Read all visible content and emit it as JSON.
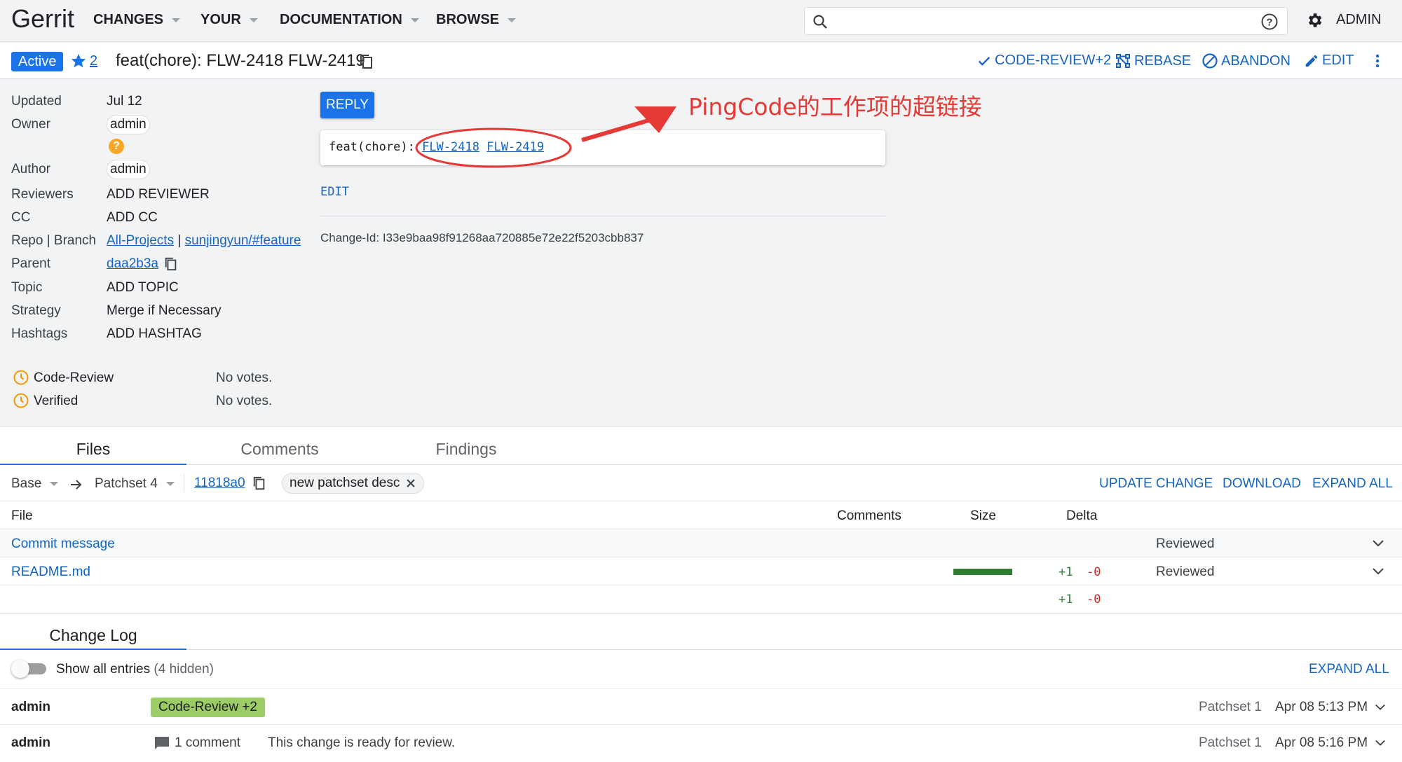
{
  "header": {
    "logo": "Gerrit",
    "nav": [
      "CHANGES",
      "YOUR",
      "DOCUMENTATION",
      "BROWSE"
    ],
    "search_placeholder": "",
    "user_menu": "ADMIN"
  },
  "change": {
    "status": "Active",
    "star_count": "2",
    "subject": "feat(chore): FLW-2418 FLW-2419",
    "actions": [
      "CODE-REVIEW+2",
      "REBASE",
      "ABANDON",
      "EDIT"
    ]
  },
  "metadata": {
    "updated_label": "Updated",
    "updated_value": "Jul 12",
    "owner_label": "Owner",
    "owner_value": "admin",
    "owner_badge": "?",
    "author_label": "Author",
    "author_value": "admin",
    "reviewers_label": "Reviewers",
    "reviewers_value": "ADD REVIEWER",
    "cc_label": "CC",
    "cc_value": "ADD CC",
    "repo_label": "Repo | Branch",
    "repo_value": "All-Projects",
    "repo_sep": " | ",
    "branch_value": "sunjingyun/#feature",
    "parent_label": "Parent",
    "parent_value": "daa2b3a",
    "topic_label": "Topic",
    "topic_value": "ADD TOPIC",
    "strategy_label": "Strategy",
    "strategy_value": "Merge if Necessary",
    "hashtags_label": "Hashtags",
    "hashtags_value": "ADD HASHTAG"
  },
  "labels": [
    {
      "name": "Code-Review",
      "value": "No votes."
    },
    {
      "name": "Verified",
      "value": "No votes."
    }
  ],
  "commit": {
    "reply": "REPLY",
    "prefix": "feat(chore):",
    "link1": "FLW-2418",
    "link2": "FLW-2419",
    "edit": "EDIT",
    "change_id": "Change-Id: I33e9baa98f91268aa720885e72e22f5203cbb837"
  },
  "annotation": "PingCode的工作项的超链接",
  "tabs": [
    "Files",
    "Comments",
    "Findings"
  ],
  "files": {
    "base": "Base",
    "patchset": "Patchset 4",
    "commit": "11818a0",
    "desc": "new patchset desc",
    "actions": [
      "UPDATE CHANGE",
      "DOWNLOAD",
      "EXPAND ALL"
    ],
    "headers": {
      "file": "File",
      "comments": "Comments",
      "size": "Size",
      "delta": "Delta"
    },
    "rows": [
      {
        "name": "Commit message",
        "plus": "",
        "minus": "",
        "status": "Reviewed"
      },
      {
        "name": "README.md",
        "plus": "+1",
        "minus": "-0",
        "status": "Reviewed"
      }
    ],
    "total_plus": "+1",
    "total_minus": "-0"
  },
  "changelog": {
    "tab": "Change Log",
    "show_all": "Show all entries",
    "hidden": "(4 hidden)",
    "expand": "EXPAND ALL",
    "entries": [
      {
        "author": "admin",
        "chip": "Code-Review +2",
        "comment": "",
        "message": "",
        "patchset": "Patchset 1",
        "date": "Apr 08 5:13 PM"
      },
      {
        "author": "admin",
        "chip": "",
        "comment": "1 comment",
        "message": "This change is ready for review.",
        "patchset": "Patchset 1",
        "date": "Apr 08 5:16 PM"
      }
    ]
  },
  "colors": {
    "accent": "#1a73e8",
    "link": "#1565c0",
    "annotation": "#e53935",
    "vote_chip": "#9ccc65",
    "added": "#2e7d32",
    "removed": "#c62828"
  }
}
